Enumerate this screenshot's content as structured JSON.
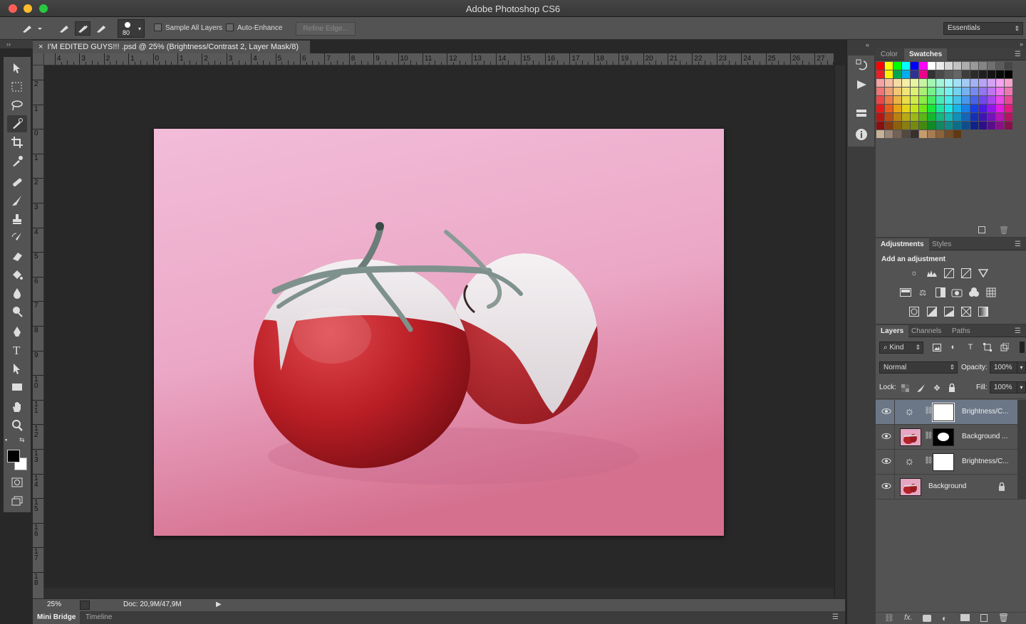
{
  "app": {
    "title": "Adobe Photoshop CS6"
  },
  "options": {
    "brush_size": "80",
    "sample_all_layers": "Sample All Layers",
    "auto_enhance": "Auto-Enhance",
    "refine_edge": "Refine Edge...",
    "workspace": "Essentials"
  },
  "document": {
    "tab_title": "I'M EDITED GUYS!!! .psd @ 25% (Brightness/Contrast 2, Layer Mask/8)",
    "zoom": "25%",
    "doc_size": "Doc: 20,9M/47,9M"
  },
  "ruler": {
    "top": [
      "4",
      "3",
      "2",
      "1",
      "0",
      "1",
      "2",
      "3",
      "4",
      "5",
      "6",
      "7",
      "8",
      "9",
      "10",
      "11",
      "12",
      "13",
      "14",
      "15",
      "16",
      "17",
      "18",
      "19",
      "20",
      "21",
      "22",
      "23",
      "24",
      "25",
      "26",
      "27"
    ],
    "left": [
      "2",
      "1",
      "0",
      "1",
      "2",
      "3",
      "4",
      "5",
      "6",
      "7",
      "8",
      "9",
      "1\n0",
      "1\n1",
      "1\n2",
      "1\n3",
      "1\n4",
      "1\n5",
      "1\n6",
      "1\n7",
      "1\n8"
    ]
  },
  "bottom_tabs": {
    "mini_bridge": "Mini Bridge",
    "timeline": "Timeline"
  },
  "color_panel": {
    "tab_color": "Color",
    "tab_swatches": "Swatches"
  },
  "adjustments_panel": {
    "tab_adjustments": "Adjustments",
    "tab_styles": "Styles",
    "heading": "Add an adjustment"
  },
  "layers_panel": {
    "tab_layers": "Layers",
    "tab_channels": "Channels",
    "tab_paths": "Paths",
    "kind": "Kind",
    "blend_mode": "Normal",
    "opacity_label": "Opacity:",
    "opacity": "100%",
    "lock_label": "Lock:",
    "fill_label": "Fill:",
    "fill": "100%",
    "layers": [
      {
        "name": "Brightness/C...",
        "type": "adjustment",
        "selected": true
      },
      {
        "name": "Background ...",
        "type": "masked"
      },
      {
        "name": "Brightness/C...",
        "type": "adjustment"
      },
      {
        "name": "Background",
        "type": "background"
      }
    ]
  },
  "colors": {
    "accent_selected": "#6b7787",
    "panel": "#535353",
    "canvas_bg": "#f0b6d4"
  }
}
